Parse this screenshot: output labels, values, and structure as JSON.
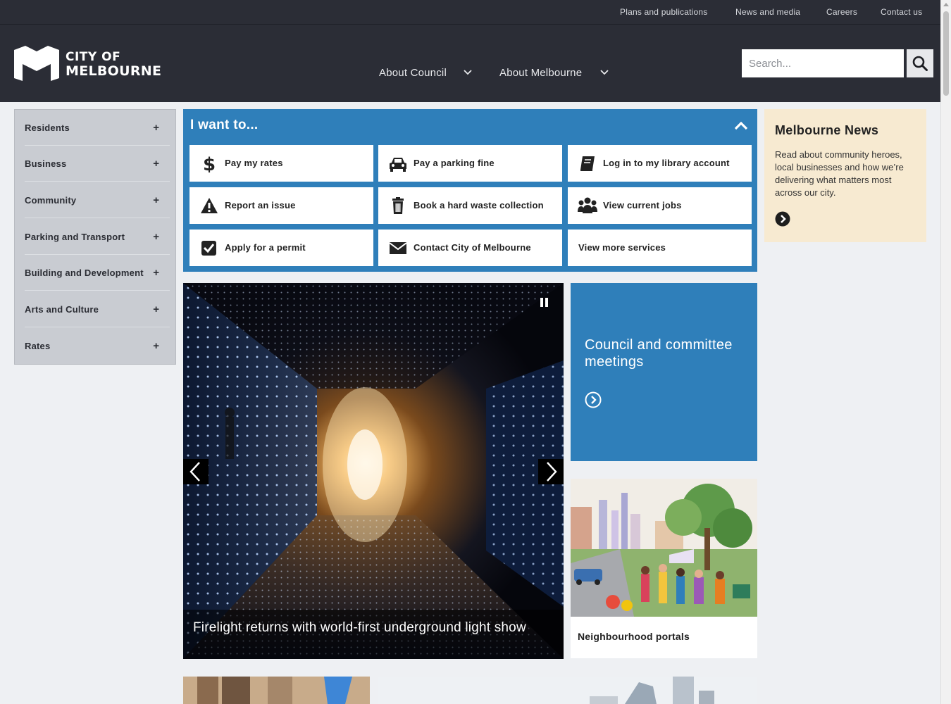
{
  "utility_nav": [
    "Plans and publications",
    "News and media",
    "Careers",
    "Contact us"
  ],
  "logo": {
    "line1": "CITY OF",
    "line2": "MELBOURNE"
  },
  "main_nav": [
    "About Council",
    "About Melbourne"
  ],
  "search": {
    "placeholder": "Search..."
  },
  "sidebar": {
    "items": [
      {
        "label": "Residents",
        "toggle": "+"
      },
      {
        "label": "Business",
        "toggle": "+"
      },
      {
        "label": "Community",
        "toggle": "+"
      },
      {
        "label": "Parking and Transport",
        "toggle": "+"
      },
      {
        "label": "Building and Development",
        "toggle": "+"
      },
      {
        "label": "Arts and Culture",
        "toggle": "+"
      },
      {
        "label": "Rates",
        "toggle": "+"
      }
    ]
  },
  "iwant": {
    "title": "I want to...",
    "services": [
      {
        "label": "Pay my rates",
        "icon": "dollar-icon"
      },
      {
        "label": "Pay a parking fine",
        "icon": "car-icon"
      },
      {
        "label": "Log in to my library account",
        "icon": "book-icon"
      },
      {
        "label": "Report an issue",
        "icon": "warning-icon"
      },
      {
        "label": "Book a hard waste collection",
        "icon": "trash-icon"
      },
      {
        "label": "View current jobs",
        "icon": "people-icon"
      },
      {
        "label": "Apply for a permit",
        "icon": "checkbox-icon"
      },
      {
        "label": "Contact City of Melbourne",
        "icon": "envelope-icon"
      },
      {
        "label": "View more services",
        "icon": ""
      }
    ]
  },
  "carousel": {
    "caption": "Firelight returns with world-first underground light show"
  },
  "council_tile": {
    "title": "Council and committee meetings"
  },
  "neighbourhood_tile": {
    "title": "Neighbourhood portals"
  },
  "news": {
    "title": "Melbourne News",
    "text": "Read about community heroes, local businesses and how we’re delivering what matters most across our city."
  },
  "colors": {
    "header": "#2b2d36",
    "accent_blue": "#2f7fba",
    "news_bg": "#f7ead1",
    "sidebar_bg": "#c9ccd2"
  }
}
